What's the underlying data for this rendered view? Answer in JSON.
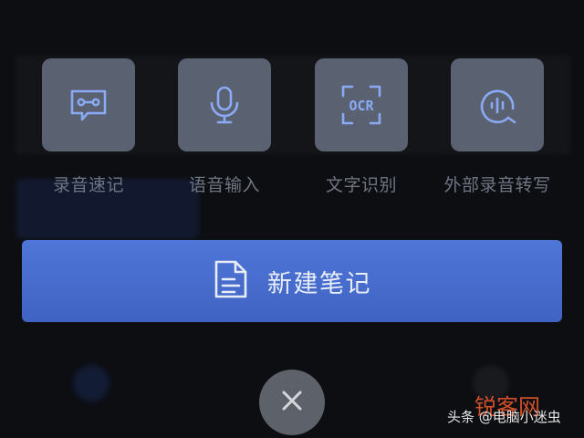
{
  "tools": [
    {
      "label": "录音速记",
      "icon": "voice-memo-icon"
    },
    {
      "label": "语音输入",
      "icon": "microphone-icon"
    },
    {
      "label": "文字识别",
      "icon": "ocr-scan-icon"
    },
    {
      "label": "外部录音转写",
      "icon": "audio-transcribe-icon"
    }
  ],
  "ocr_icon_text": "OCR",
  "new_note": {
    "label": "新建笔记",
    "icon": "document-icon"
  },
  "close": {
    "icon": "close-icon"
  },
  "watermark": {
    "prefix": "头条",
    "handle": "@电脑小迷虫",
    "brand": "锐客网"
  },
  "colors": {
    "background": "#0c0e12",
    "tile": "#5a6170",
    "icon": "#8aaaf5",
    "label": "#6f7582",
    "primary_button": "#4a6fd3",
    "close_button": "#5c616a",
    "watermark_brand": "#e0552d"
  }
}
